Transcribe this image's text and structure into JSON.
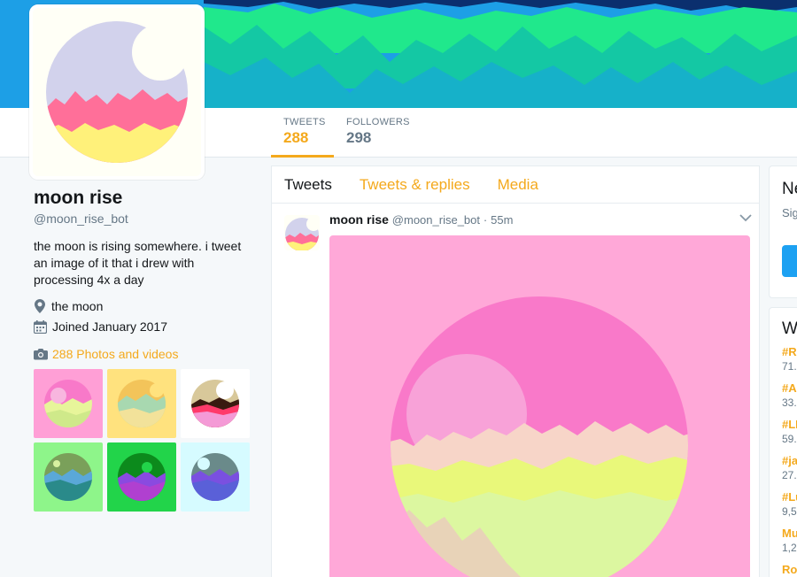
{
  "colors": {
    "accent": "#f4a91c",
    "banner_blue": "#1da1f2",
    "text_primary": "#14171a",
    "text_secondary": "#657786",
    "panel_bg": "#f5f8fa"
  },
  "nav": {
    "tweets_label": "TWEETS",
    "tweets_count": "288",
    "followers_label": "FOLLOWERS",
    "followers_count": "298"
  },
  "profile": {
    "name": "moon rise",
    "handle": "@moon_rise_bot",
    "bio": "the moon is rising somewhere. i tweet an image of it that i drew with processing 4x a day",
    "location": "the moon",
    "joined": "Joined January 2017",
    "photos_link": "288 Photos and videos"
  },
  "timeline": {
    "tabs": [
      "Tweets",
      "Tweets & replies",
      "Media"
    ],
    "tweet": {
      "author": "moon rise",
      "handle": "@moon_rise_bot",
      "dot": "·",
      "time": "55m"
    }
  },
  "right_sidebar": {
    "login_title": "Ne",
    "login_text": "Sig pe",
    "trends_title": "W",
    "trends": [
      {
        "name": "#RA",
        "count": "71."
      },
      {
        "name": "#Al",
        "count": "33."
      },
      {
        "name": "#LI",
        "count": "59."
      },
      {
        "name": "#ja",
        "count": "27."
      },
      {
        "name": "#Lu",
        "count": "9,5"
      },
      {
        "name": "Mu",
        "count": "1,2"
      },
      {
        "name": "Ro",
        "count": ""
      }
    ]
  }
}
